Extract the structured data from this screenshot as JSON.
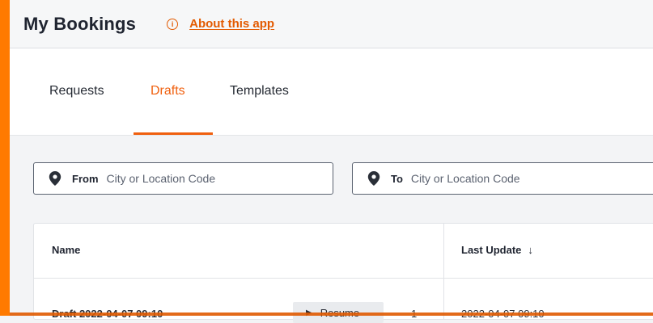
{
  "header": {
    "title": "My Bookings",
    "about_label": "About this app",
    "about_icon": "info-icon"
  },
  "tabs": [
    {
      "label": "Requests",
      "active": false
    },
    {
      "label": "Drafts",
      "active": true
    },
    {
      "label": "Templates",
      "active": false
    }
  ],
  "filters": {
    "from": {
      "label": "From",
      "placeholder": "City or Location Code",
      "icon": "location-pin-icon"
    },
    "to": {
      "label": "To",
      "placeholder": "City or Location Code",
      "icon": "location-pin-icon"
    }
  },
  "table": {
    "columns": [
      {
        "label": "Name"
      },
      {
        "label": "Last Update",
        "sort": "descending",
        "sort_icon": "arrow-down-icon"
      }
    ],
    "rows": [
      {
        "name": "Draft 2022-04-07 09:10",
        "action": "Resume",
        "count": "1",
        "last_update": "2022-04-07 09:10"
      }
    ]
  },
  "colors": {
    "accent": "#ff7a00",
    "active_tab": "#f0600f",
    "link": "#e35a00"
  }
}
